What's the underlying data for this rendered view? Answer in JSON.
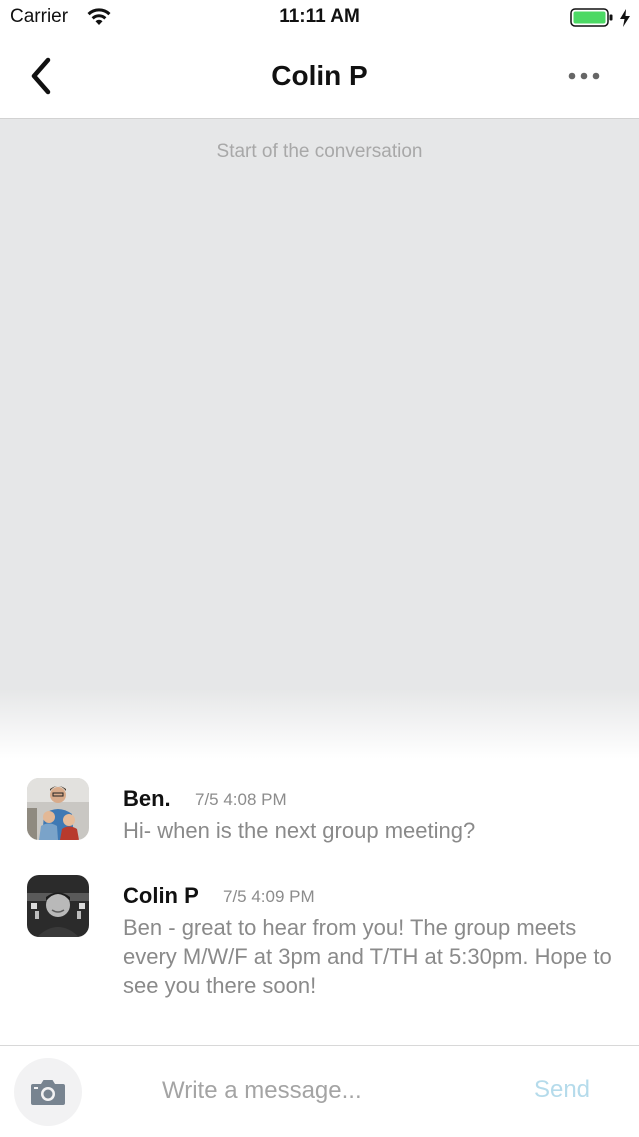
{
  "status_bar": {
    "carrier": "Carrier",
    "time": "11:11 AM",
    "icons": [
      "wifi-icon",
      "battery-icon",
      "charging-bolt-icon"
    ],
    "battery_color": "#4cd964"
  },
  "nav": {
    "title": "Colin P",
    "back_icon": "chevron-left-icon",
    "more_icon": "more-horizontal-icon"
  },
  "conversation": {
    "start_label": "Start of the conversation",
    "background_color": "#e6e7e8",
    "messages": [
      {
        "author": "Ben.",
        "time": "7/5 4:08 PM",
        "text": "Hi- when is the next group meeting?",
        "avatar": "photo-avatar"
      },
      {
        "author": "Colin P",
        "time": "7/5 4:09 PM",
        "text": "Ben - great to hear from you! The group meets every M/W/F at 3pm and T/TH at 5:30pm. Hope to see you there soon!",
        "avatar": "photo-avatar"
      }
    ]
  },
  "composer": {
    "placeholder": "Write a message...",
    "value": "",
    "send_label": "Send",
    "send_color": "#b5dbeb",
    "camera_icon": "camera-icon"
  }
}
